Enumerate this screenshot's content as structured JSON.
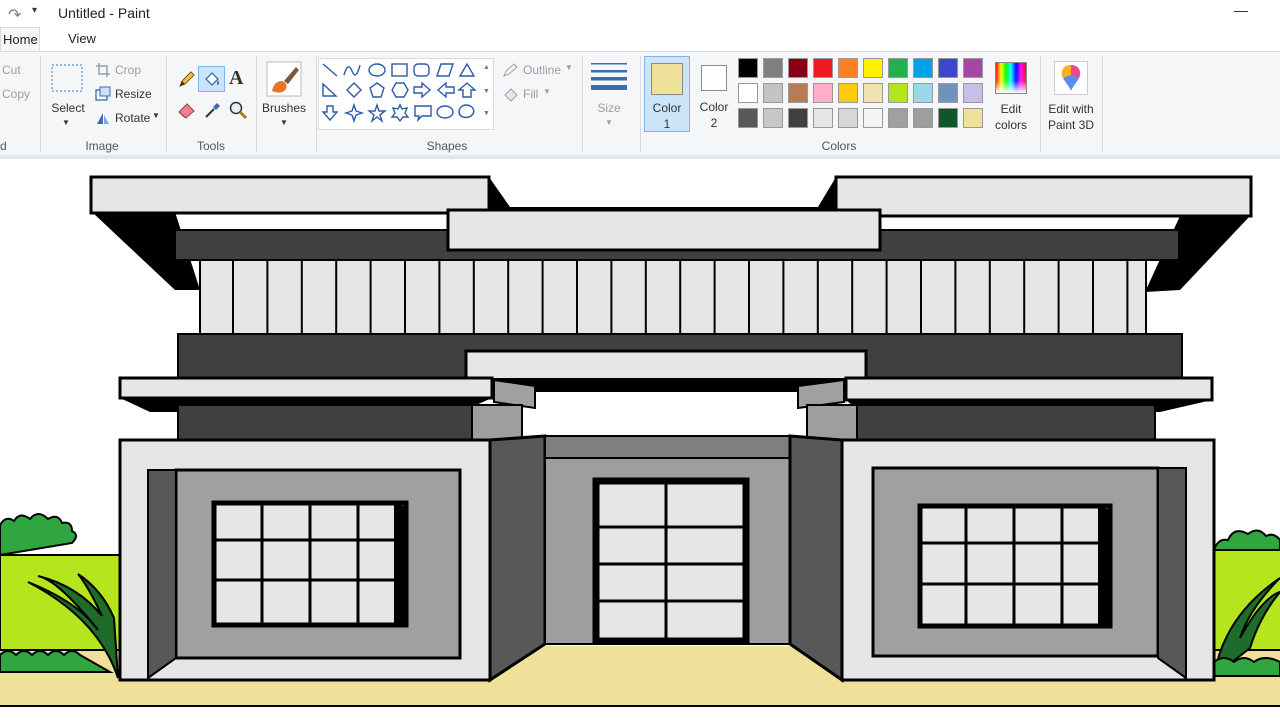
{
  "window": {
    "title": "Untitled - Paint",
    "minimize": "—"
  },
  "tabs": [
    {
      "label": "Home"
    },
    {
      "label": "View"
    }
  ],
  "clipboard": {
    "cut": "Cut",
    "copy": "Copy",
    "group_label": "d"
  },
  "image": {
    "select": "Select",
    "crop": "Crop",
    "resize": "Resize",
    "rotate": "Rotate",
    "group_label": "Image"
  },
  "tools": {
    "group_label": "Tools"
  },
  "brushes": {
    "label": "Brushes"
  },
  "shapes": {
    "outline": "Outline",
    "fill": "Fill",
    "group_label": "Shapes"
  },
  "size": {
    "label": "Size"
  },
  "color1": {
    "label": "Color",
    "num": "1",
    "value": "#efe09a"
  },
  "color2": {
    "label": "Color",
    "num": "2",
    "value": "#ffffff"
  },
  "colors": {
    "group_label": "Colors",
    "edit_colors_1": "Edit",
    "edit_colors_2": "colors",
    "palette": [
      [
        "#000000",
        "#7f7f7f",
        "#880015",
        "#ed1c24",
        "#ff7f27",
        "#fff200",
        "#22b14c",
        "#00a2e8",
        "#3f48cc",
        "#a349a4"
      ],
      [
        "#ffffff",
        "#c3c3c3",
        "#b97a57",
        "#ffaec9",
        "#ffc90e",
        "#efe4b0",
        "#b5e61d",
        "#99d9ea",
        "#7092be",
        "#c8bfe7"
      ],
      [
        "#585858",
        "#c8c8c8",
        "#404040",
        "#e6e6e6",
        "#d7d7d7",
        "#f4f4f4",
        "#a0a0a0",
        "#9e9e9e",
        "#0e5527",
        "#efe09a"
      ]
    ]
  },
  "paint3d": {
    "line1": "Edit with",
    "line2": "Paint 3D"
  }
}
